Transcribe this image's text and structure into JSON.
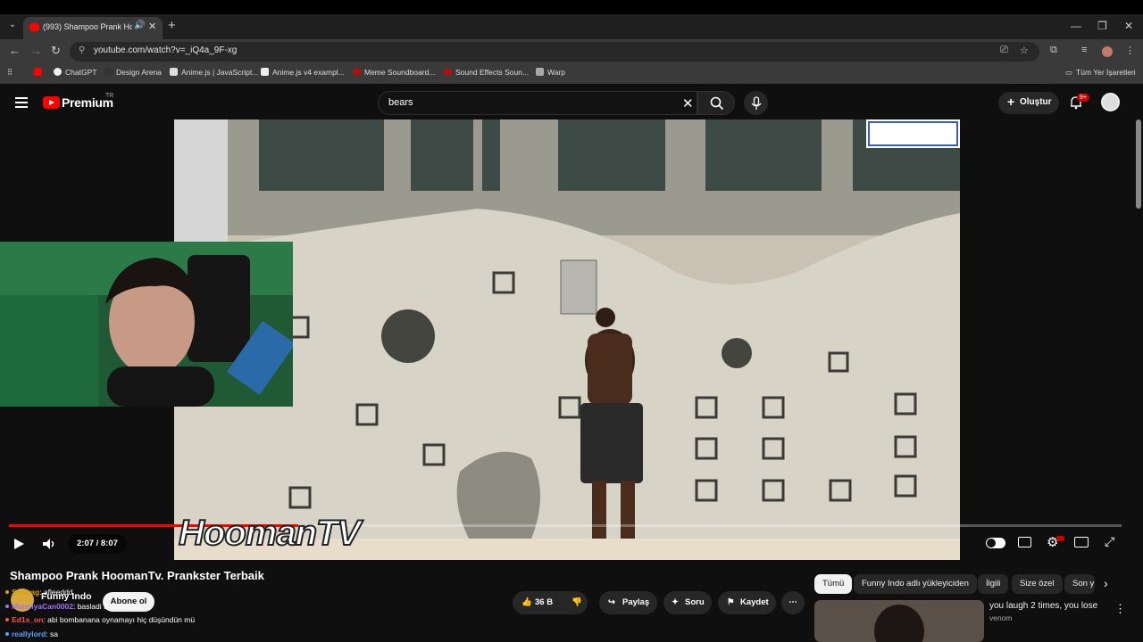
{
  "browser": {
    "tab_title": "(993) Shampoo Prank Hoom",
    "url": "youtube.com/watch?v=_iQ4a_9F-xg",
    "bookmarks": [
      "ChatGPT",
      "Design Arena",
      "Anime.js | JavaScript...",
      "Anime.js v4 exampl...",
      "Meme Soundboard...",
      "Sound Effects Soun...",
      "Warp"
    ],
    "all_bookmarks": "Tüm Yer İşaretleri"
  },
  "youtube": {
    "logo": "Premium",
    "region": "TR",
    "search_value": "bears",
    "create_label": "Oluştur",
    "notif_badge": "9+"
  },
  "player": {
    "time": "2:07 / 8:07",
    "progress": 0.26,
    "watermark": "HoomanTV"
  },
  "video_info": {
    "title": "Shampoo Prank HoomanTv. Prankster Terbaik",
    "channel": "Funny Indo",
    "subscribe": "Abone ol",
    "likes": "36 B",
    "share": "Paylaş",
    "ask": "Soru",
    "save": "Kaydet"
  },
  "chat": [
    {
      "user": "Sedirag",
      "msg": ": afleeddd",
      "color": "#d9a300"
    },
    {
      "user": "ManolyaCan0002",
      "msg": ": basladi 3 daldıkdo",
      "color": "#a070ff"
    },
    {
      "user": "Ed1s_on",
      "msg": ": abi bombanana oynamayı hiç düşündün mü",
      "color": "#ff5050"
    },
    {
      "user": "reallylord",
      "msg": ": sa",
      "color": "#60a0ff"
    }
  ],
  "recommend": {
    "chips": [
      "Tümü",
      "Funny Indo adlı yükleyiciden",
      "İlgili",
      "Size özel",
      "Son y"
    ],
    "item_title": "you laugh 2 times, you lose",
    "item_channel": "venom"
  }
}
